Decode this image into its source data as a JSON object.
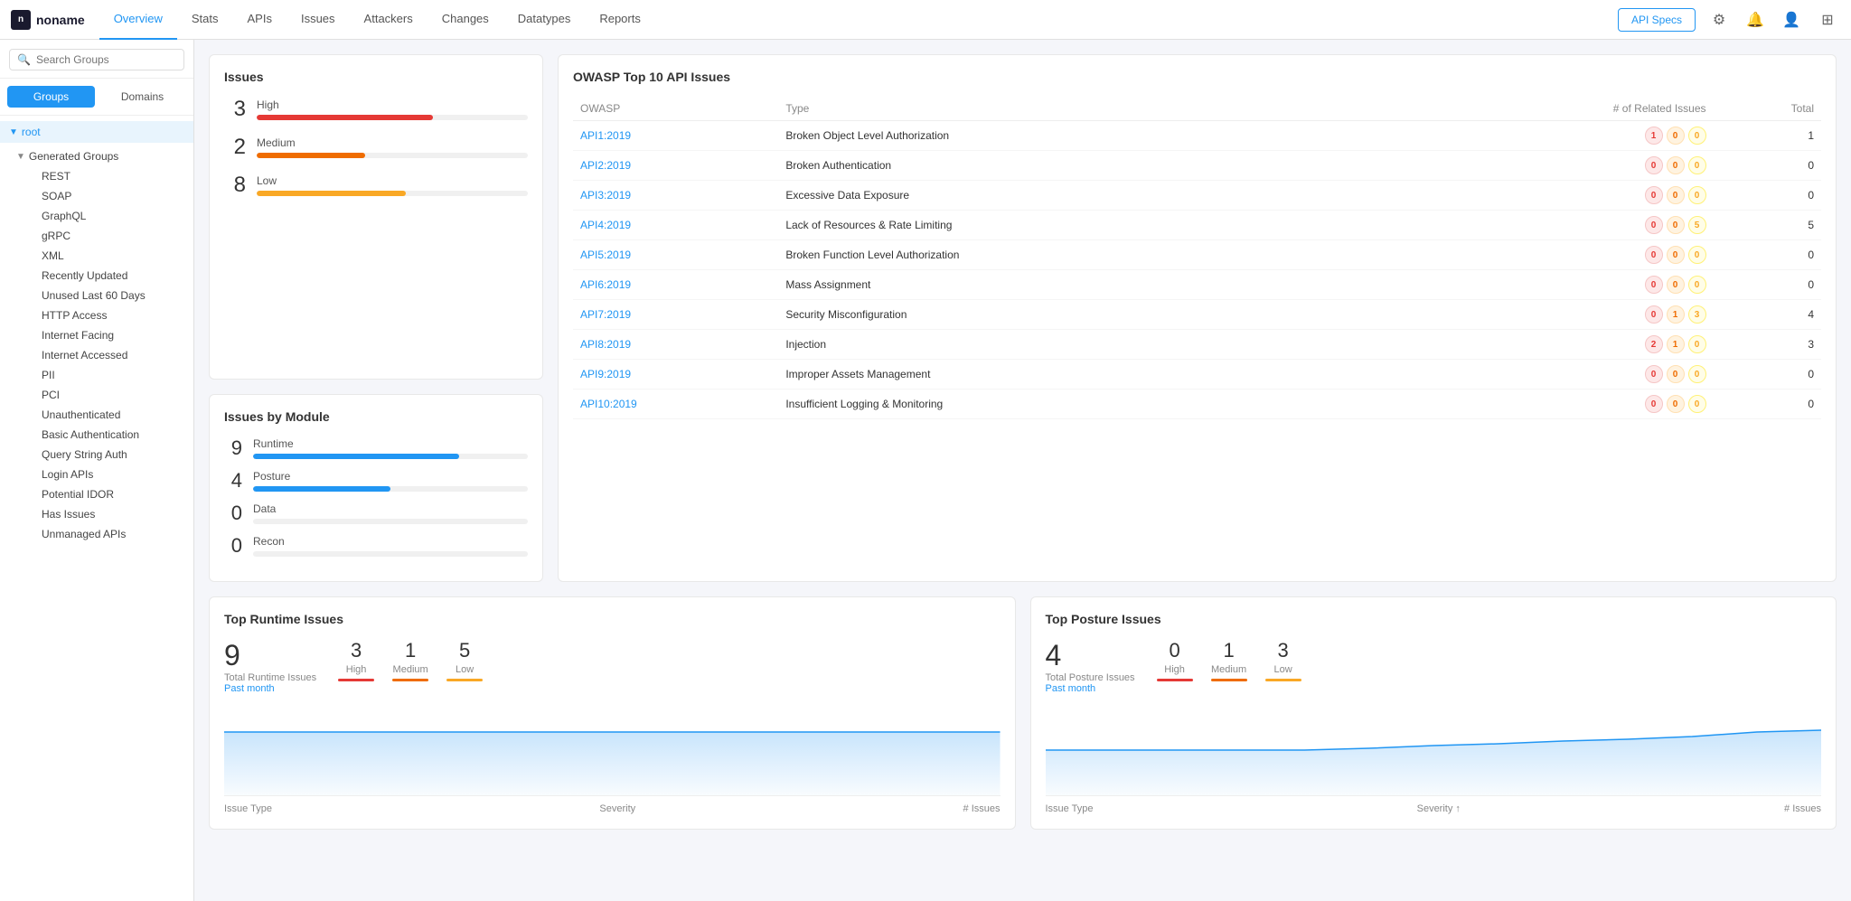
{
  "app": {
    "logo_text": "noname",
    "logo_initial": "n"
  },
  "nav": {
    "items": [
      {
        "label": "Overview",
        "active": true
      },
      {
        "label": "Stats",
        "active": false
      },
      {
        "label": "APIs",
        "active": false
      },
      {
        "label": "Issues",
        "active": false
      },
      {
        "label": "Attackers",
        "active": false
      },
      {
        "label": "Changes",
        "active": false
      },
      {
        "label": "Datatypes",
        "active": false
      },
      {
        "label": "Reports",
        "active": false
      }
    ],
    "api_specs_label": "API Specs"
  },
  "sidebar": {
    "search_placeholder": "Search Groups",
    "tabs": [
      {
        "label": "Groups",
        "active": true
      },
      {
        "label": "Domains",
        "active": false
      }
    ],
    "root_label": "root",
    "generated_groups_label": "Generated Groups",
    "tree_items": [
      "REST",
      "SOAP",
      "GraphQL",
      "gRPC",
      "XML",
      "Recently Updated",
      "Unused Last 60 Days",
      "HTTP Access",
      "Internet Facing",
      "Internet Accessed",
      "PII",
      "PCI",
      "Unauthenticated",
      "Basic Authentication",
      "Query String Auth",
      "Login APIs",
      "Potential IDOR",
      "Has Issues",
      "Unmanaged APIs"
    ]
  },
  "issues": {
    "title": "Issues",
    "rows": [
      {
        "count": "3",
        "label": "High",
        "bar_width": "65%",
        "color": "#e53935"
      },
      {
        "count": "2",
        "label": "Medium",
        "bar_width": "40%",
        "color": "#ef6c00"
      },
      {
        "count": "8",
        "label": "Low",
        "bar_width": "55%",
        "color": "#f9a825"
      }
    ]
  },
  "issues_by_module": {
    "title": "Issues by Module",
    "rows": [
      {
        "count": "9",
        "label": "Runtime",
        "bar_width": "75%",
        "color": "#2196f3"
      },
      {
        "count": "4",
        "label": "Posture",
        "bar_width": "50%",
        "color": "#2196f3"
      },
      {
        "count": "0",
        "label": "Data",
        "bar_width": "0%",
        "color": "#2196f3"
      },
      {
        "count": "0",
        "label": "Recon",
        "bar_width": "0%",
        "color": "#2196f3"
      }
    ]
  },
  "owasp": {
    "title": "OWASP Top 10 API Issues",
    "columns": {
      "owasp": "OWASP",
      "type": "Type",
      "related": "# of Related Issues",
      "total": "Total"
    },
    "rows": [
      {
        "id": "API1:2019",
        "type": "Broken Object Level Authorization",
        "badges": [
          1,
          0,
          0
        ],
        "total": "1"
      },
      {
        "id": "API2:2019",
        "type": "Broken Authentication",
        "badges": [
          0,
          0,
          0
        ],
        "total": "0"
      },
      {
        "id": "API3:2019",
        "type": "Excessive Data Exposure",
        "badges": [
          0,
          0,
          0
        ],
        "total": "0"
      },
      {
        "id": "API4:2019",
        "type": "Lack of Resources & Rate Limiting",
        "badges": [
          0,
          0,
          5
        ],
        "total": "5"
      },
      {
        "id": "API5:2019",
        "type": "Broken Function Level Authorization",
        "badges": [
          0,
          0,
          0
        ],
        "total": "0"
      },
      {
        "id": "API6:2019",
        "type": "Mass Assignment",
        "badges": [
          0,
          0,
          0
        ],
        "total": "0"
      },
      {
        "id": "API7:2019",
        "type": "Security Misconfiguration",
        "badges": [
          0,
          1,
          3
        ],
        "total": "4"
      },
      {
        "id": "API8:2019",
        "type": "Injection",
        "badges": [
          2,
          1,
          0
        ],
        "total": "3"
      },
      {
        "id": "API9:2019",
        "type": "Improper Assets Management",
        "badges": [
          0,
          0,
          0
        ],
        "total": "0"
      },
      {
        "id": "API10:2019",
        "type": "Insufficient Logging & Monitoring",
        "badges": [
          0,
          0,
          0
        ],
        "total": "0"
      }
    ]
  },
  "runtime": {
    "title": "Top Runtime Issues",
    "total": "9",
    "total_label": "Total Runtime Issues",
    "sub_label": "Past month",
    "severities": [
      {
        "num": "3",
        "label": "High",
        "color": "#e53935"
      },
      {
        "num": "1",
        "label": "Medium",
        "color": "#ef6c00"
      },
      {
        "num": "5",
        "label": "Low",
        "color": "#f9a825"
      }
    ],
    "table": {
      "col1": "Issue Type",
      "col2": "Severity",
      "col3": "# Issues"
    }
  },
  "posture": {
    "title": "Top Posture Issues",
    "total": "4",
    "total_label": "Total Posture Issues",
    "sub_label": "Past month",
    "severities": [
      {
        "num": "0",
        "label": "High",
        "color": "#e53935"
      },
      {
        "num": "1",
        "label": "Medium",
        "color": "#ef6c00"
      },
      {
        "num": "3",
        "label": "Low",
        "color": "#f9a825"
      }
    ],
    "table": {
      "col1": "Issue Type",
      "col2": "Severity",
      "col3": "# Issues"
    }
  }
}
